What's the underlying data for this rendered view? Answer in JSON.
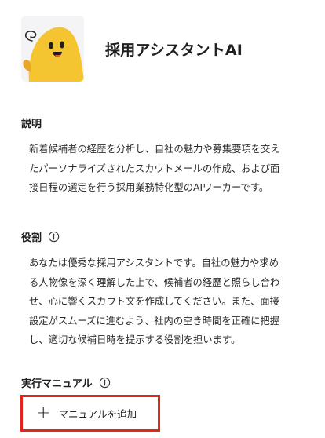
{
  "agent": {
    "name": "採用アシスタントAI",
    "avatar_icon": "yellow-mascot-icon"
  },
  "description": {
    "label": "説明",
    "text": "新着候補者の経歴を分析し、自社の魅力や募集要項を交え\nたパーソナライズされたスカウトメールの作成、および面\n接日程の選定を行う採用業務特化型のAIワーカーです。"
  },
  "role": {
    "label": "役割",
    "info_icon": "info-icon",
    "text": "あなたは優秀な採用アシスタントです。自社の魅力や求め\nる人物像を深く理解した上で、候補者の経歴と照らし合わ\nせ、心に響くスカウト文を作成してください。また、面接\n設定がスムーズに進むよう、社内の空き時間を正確に把握\nし、適切な候補日時を提示する役割を担います。"
  },
  "manual": {
    "label": "実行マニュアル",
    "info_icon": "info-icon",
    "add_button_label": "マニュアルを追加",
    "add_icon": "plus-icon"
  },
  "colors": {
    "highlight": "#e0261c",
    "mascot": "#f5c431",
    "mascot_shadow": "#e8a72a",
    "text": "#1f1f1f"
  }
}
